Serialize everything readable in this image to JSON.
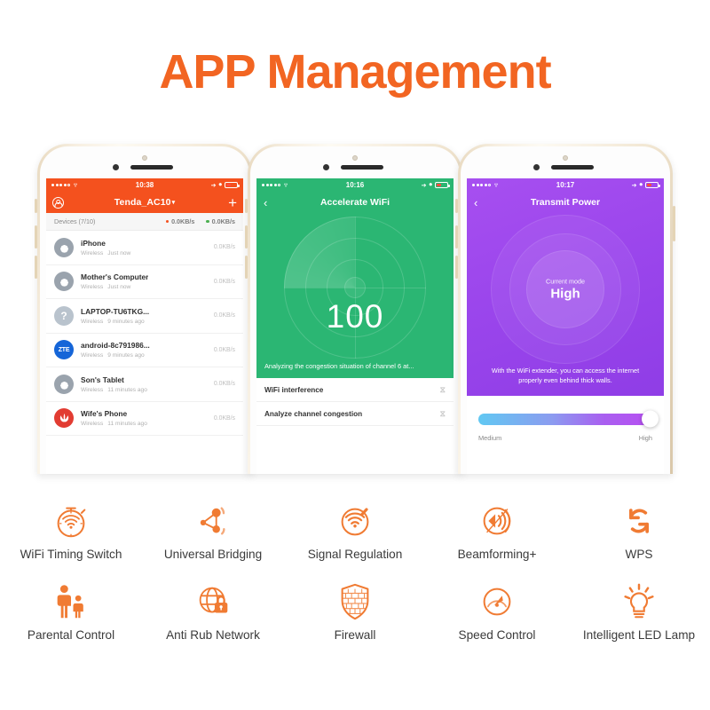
{
  "header": {
    "title": "APP Management",
    "accent_color": "#F26522"
  },
  "phones": [
    {
      "id": "device-list",
      "status_bar": {
        "time": "10:38",
        "signal": "signal-dots",
        "wifi": "wifi-icon",
        "battery": "battery-icon"
      },
      "nav": {
        "avatar": "account-icon",
        "ssid": "Tenda_AC10",
        "caret": "▾",
        "add": "+"
      },
      "summary": {
        "devices_label": "Devices (7/10)",
        "upload_rate": "0.0KB/s",
        "download_rate": "0.0KB/s"
      },
      "devices": [
        {
          "icon": "apple-icon",
          "name": "iPhone",
          "conn": "Wireless",
          "seen": "Just now",
          "rate": "0.0KB/s"
        },
        {
          "icon": "apple-icon",
          "name": "Mother's Computer",
          "conn": "Wireless",
          "seen": "Just now",
          "rate": "0.0KB/s"
        },
        {
          "icon": "question-icon",
          "name": "LAPTOP-TU6TKG...",
          "conn": "Wireless",
          "seen": "9 minutes ago",
          "rate": "0.0KB/s"
        },
        {
          "icon": "zte-icon",
          "name": "android-8c791986...",
          "conn": "Wireless",
          "seen": "9 minutes ago",
          "rate": "0.0KB/s",
          "badge": "ZTE"
        },
        {
          "icon": "apple-icon",
          "name": "Son's Tablet",
          "conn": "Wireless",
          "seen": "11 minutes ago",
          "rate": "0.0KB/s"
        },
        {
          "icon": "huawei-icon",
          "name": "Wife's Phone",
          "conn": "Wireless",
          "seen": "11 minutes ago",
          "rate": "0.0KB/s"
        }
      ]
    },
    {
      "id": "accelerate-wifi",
      "theme_color": "#2BB673",
      "status_bar": {
        "time": "10:16"
      },
      "nav": {
        "back": "‹",
        "title": "Accelerate WiFi"
      },
      "score": "100",
      "status_line": "Analyzing the congestion situation of channel 6 at...",
      "items": [
        {
          "label": "WiFi interference",
          "state": "spinner-icon"
        },
        {
          "label": "Analyze channel congestion",
          "state": "spinner-icon"
        }
      ]
    },
    {
      "id": "transmit-power",
      "theme_color": "#9B46EC",
      "status_bar": {
        "time": "10:17"
      },
      "nav": {
        "back": "‹",
        "title": "Transmit Power"
      },
      "current_mode_label": "Current mode",
      "current_mode_value": "High",
      "description": "With the WiFi extender, you can access the internet properly even behind thick walls.",
      "slider": {
        "min_label": "Medium",
        "max_label": "High",
        "value_percent": 100
      }
    }
  ],
  "features": {
    "row1": [
      {
        "icon": "wifi-timer-icon",
        "label": "WiFi Timing Switch"
      },
      {
        "icon": "bridge-nodes-icon",
        "label": "Universal Bridging"
      },
      {
        "icon": "signal-pen-icon",
        "label": "Signal Regulation"
      },
      {
        "icon": "beamforming-icon",
        "label": "Beamforming+"
      },
      {
        "icon": "wps-refresh-icon",
        "label": "WPS"
      }
    ],
    "row2": [
      {
        "icon": "parent-child-icon",
        "label": "Parental Control"
      },
      {
        "icon": "globe-lock-icon",
        "label": "Anti Rub Network"
      },
      {
        "icon": "brick-shield-icon",
        "label": "Firewall"
      },
      {
        "icon": "speedometer-icon",
        "label": "Speed Control"
      },
      {
        "icon": "led-bulb-icon",
        "label": "Intelligent LED Lamp"
      }
    ],
    "icon_color": "#F07B33"
  }
}
